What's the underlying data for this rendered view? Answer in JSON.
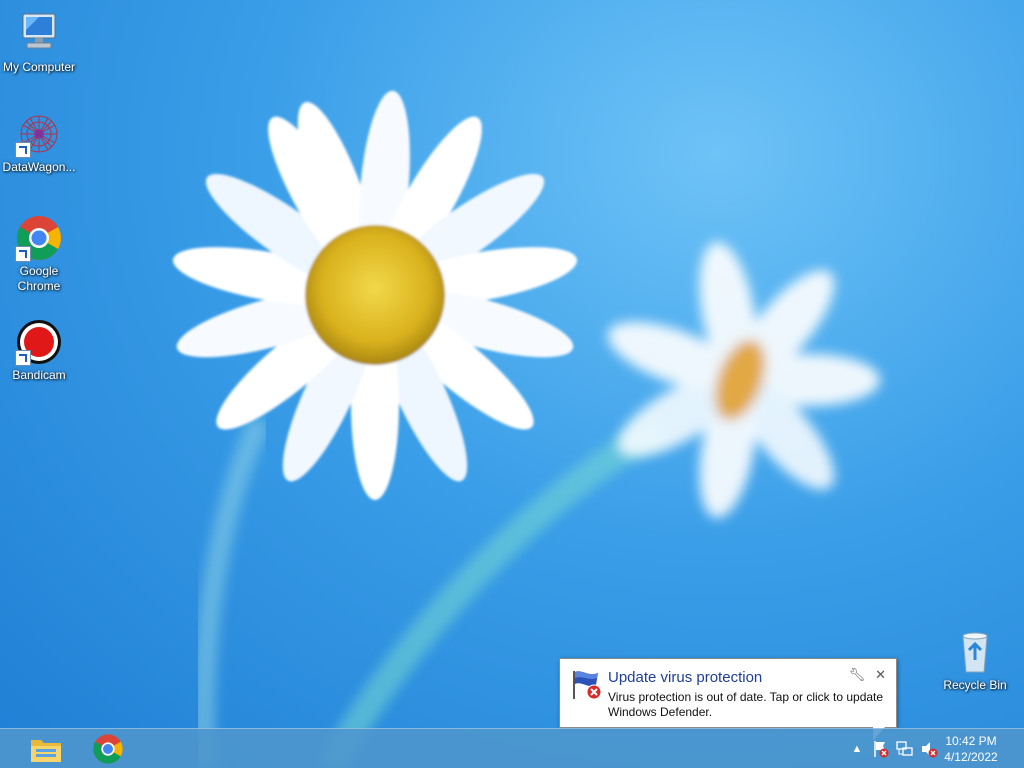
{
  "desktop": {
    "icons": [
      {
        "label": "My Computer",
        "icon": "computer-icon",
        "shortcut": false
      },
      {
        "label": "DataWagon...",
        "icon": "datawagon-icon",
        "shortcut": true
      },
      {
        "label": "Google Chrome",
        "icon": "chrome-icon",
        "shortcut": true
      },
      {
        "label": "Bandicam",
        "icon": "bandicam-icon",
        "shortcut": true
      },
      {
        "label": "Recycle Bin",
        "icon": "recycle-bin-icon",
        "shortcut": false
      }
    ]
  },
  "notification": {
    "title": "Update virus protection",
    "body": "Virus protection is out of date. Tap or click to update Windows Defender.",
    "icon": "defender-flag-icon",
    "options_icon": "wrench-icon",
    "close_icon": "close-icon"
  },
  "taskbar": {
    "pinned": [
      {
        "name": "file-explorer",
        "icon": "folder-icon"
      },
      {
        "name": "google-chrome",
        "icon": "chrome-icon"
      }
    ],
    "tray": {
      "icons": [
        "show-hidden-icons-arrow",
        "action-center-flag-icon",
        "network-icon",
        "volume-muted-icon"
      ]
    },
    "clock": {
      "time": "10:42 PM",
      "date": "4/12/2022"
    }
  },
  "colors": {
    "accent": "#1e3e99",
    "taskbar": "#4e96cd",
    "alert_red": "#d62b2b"
  }
}
